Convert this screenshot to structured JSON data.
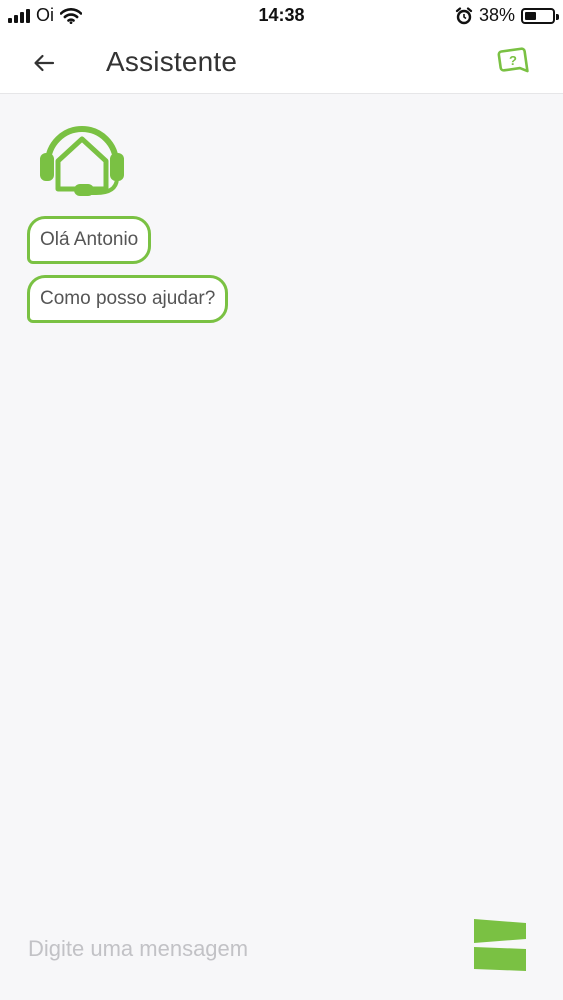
{
  "status_bar": {
    "carrier": "Oi",
    "time": "14:38",
    "battery": "38%",
    "battery_level": 0.38,
    "icons": [
      "signal-icon",
      "wifi-icon",
      "alarm-icon",
      "battery-icon"
    ]
  },
  "header": {
    "title": "Assistente",
    "back_icon": "arrow-left-icon",
    "help_icon": "help-chat-icon"
  },
  "chat": {
    "avatar_icon": "support-house-headset-icon",
    "messages": [
      {
        "sender": "assistant",
        "text": "Olá Antonio"
      },
      {
        "sender": "assistant",
        "text": "Como posso ajudar?"
      }
    ]
  },
  "composer": {
    "placeholder": "Digite uma mensagem",
    "value": "",
    "send_icon": "send-icon"
  },
  "colors": {
    "accent": "#7ac143",
    "background": "#f7f7f9",
    "header_bg": "#ffffff",
    "text": "#333333",
    "placeholder": "#c2c2c6"
  }
}
